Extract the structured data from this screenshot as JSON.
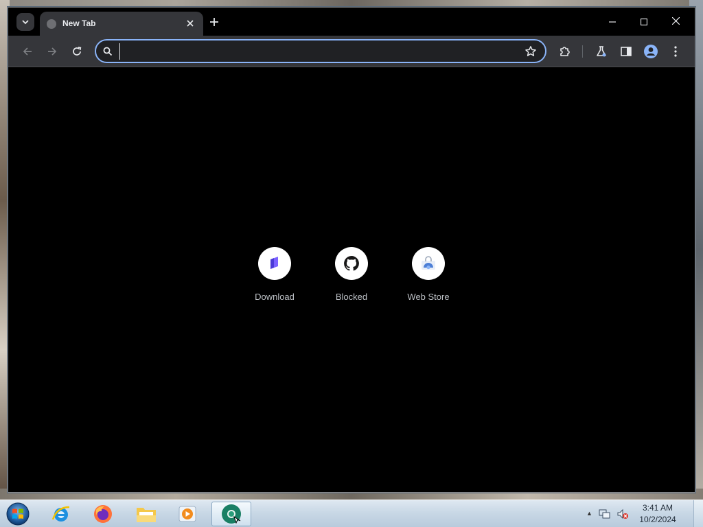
{
  "browser": {
    "tab": {
      "title": "New Tab"
    },
    "omnibox": {
      "value": "",
      "placeholder": ""
    }
  },
  "shortcuts": [
    {
      "label": "Download",
      "icon": "download-site-icon"
    },
    {
      "label": "Blocked",
      "icon": "github-icon"
    },
    {
      "label": "Web Store",
      "icon": "web-store-icon"
    }
  ],
  "taskbar": {
    "apps": [
      "internet-explorer-icon",
      "firefox-icon",
      "file-explorer-icon",
      "media-player-icon",
      "chrome-icon"
    ],
    "clock": {
      "time": "3:41 AM",
      "date": "10/2/2024"
    }
  },
  "colors": {
    "accent": "#8ab4f8",
    "toolbar": "#35363a",
    "page_bg": "#000000"
  }
}
